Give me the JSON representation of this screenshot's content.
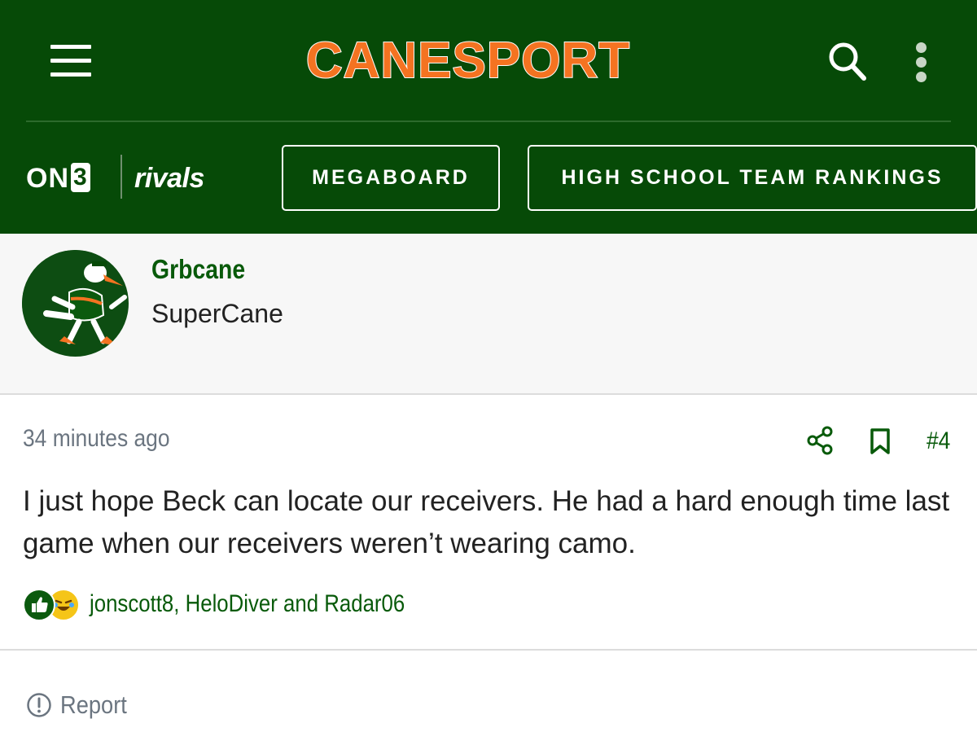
{
  "header": {
    "logo_text": "CANESPORT",
    "partner_on3": "ON",
    "partner_on3_mark": "3",
    "partner_rivals": "rivals",
    "nav_buttons": [
      "MEGABOARD",
      "HIGH SCHOOL TEAM RANKINGS"
    ],
    "colors": {
      "brand_green": "#064a07",
      "logo_orange": "#f47321"
    },
    "icons": [
      "menu-icon",
      "search-icon",
      "more-vertical-icon"
    ]
  },
  "author": {
    "username": "Grbcane",
    "title": "SuperCane",
    "avatar": "miami-ibis-mascot-avatar"
  },
  "post": {
    "timestamp": "34 minutes ago",
    "post_number": "#4",
    "body": "I just hope Beck can locate our receivers. He had a hard enough time last game when our receivers weren’t wearing camo.",
    "icons": [
      "share-icon",
      "bookmark-icon"
    ],
    "reactions": {
      "types": [
        "like-icon",
        "laugh-icon"
      ],
      "users": "jonscott8, HeloDiver and Radar06"
    }
  },
  "footer": {
    "report_label": "Report",
    "report_icon": "alert-circle-icon"
  }
}
